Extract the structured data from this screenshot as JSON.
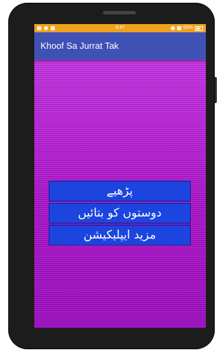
{
  "status_bar": {
    "time": "8:47",
    "battery": "93%",
    "background_color": "#f0a21e"
  },
  "app_bar": {
    "title": "Khoof Sa Jurrat Tak",
    "background_color": "#3f51b5"
  },
  "content": {
    "background_color": "#b01fd6"
  },
  "menu": {
    "buttons": [
      {
        "label": "پڑھیے"
      },
      {
        "label": "دوستوں کو بتائیں"
      },
      {
        "label": "مزید ایپلیکیشن"
      }
    ],
    "button_color": "#1c45e0"
  }
}
